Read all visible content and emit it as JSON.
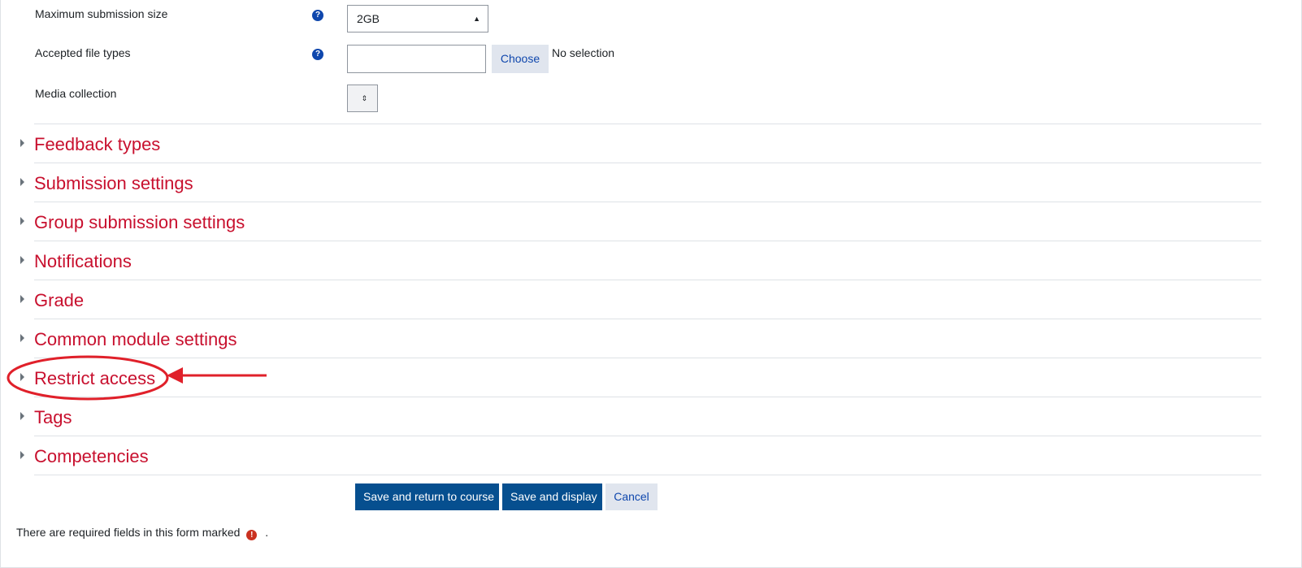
{
  "fields": {
    "max_size": {
      "label": "Maximum submission size",
      "value": "2GB"
    },
    "file_types": {
      "label": "Accepted file types",
      "choose_label": "Choose",
      "selection_text": "No selection"
    },
    "media_collection": {
      "label": "Media collection",
      "value": ""
    }
  },
  "sections": [
    {
      "title": "Feedback types"
    },
    {
      "title": "Submission settings"
    },
    {
      "title": "Group submission settings"
    },
    {
      "title": "Notifications"
    },
    {
      "title": "Grade"
    },
    {
      "title": "Common module settings"
    },
    {
      "title": "Restrict access"
    },
    {
      "title": "Tags"
    },
    {
      "title": "Competencies"
    }
  ],
  "buttons": {
    "save_return": "Save and return to course",
    "save_display": "Save and display",
    "cancel": "Cancel"
  },
  "footer": {
    "required_note": "There are required fields in this form marked",
    "required_suffix": "."
  },
  "icons": {
    "help": "question-circle-icon",
    "required": "exclamation-circle-icon",
    "expand": "triangle-right-icon"
  },
  "colors": {
    "section_title": "#c8102e",
    "primary_button": "#064f8f",
    "secondary_button": "#e0e5ee",
    "annotation": "#e0202a"
  }
}
